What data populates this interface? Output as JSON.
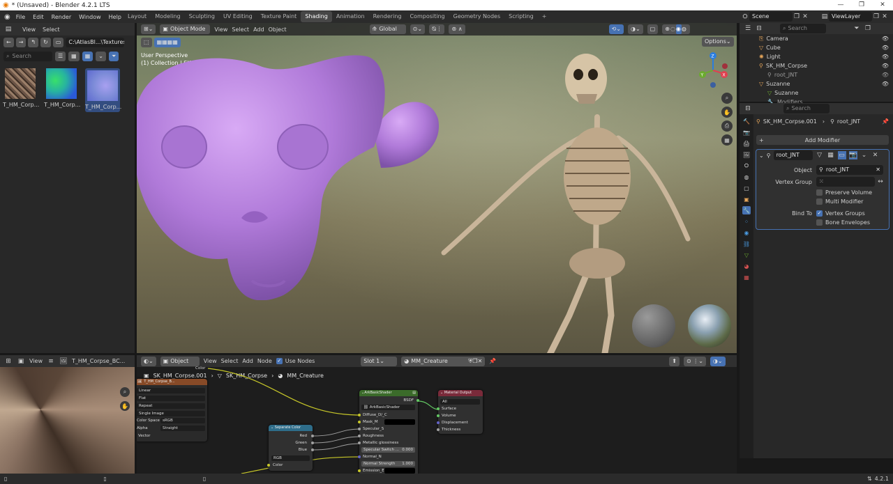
{
  "title_bar": {
    "title": "* (Unsaved) - Blender 4.2.1 LTS",
    "min": "—",
    "max": "❐",
    "close": "✕"
  },
  "menu": [
    "File",
    "Edit",
    "Render",
    "Window",
    "Help"
  ],
  "workspaces": [
    "Layout",
    "Modeling",
    "Sculpting",
    "UV Editing",
    "Texture Paint",
    "Shading",
    "Animation",
    "Rendering",
    "Compositing",
    "Geometry Nodes",
    "Scripting"
  ],
  "add_workspace": "+",
  "scene_name": "Scene",
  "view_layer": "ViewLayer",
  "file_browser": {
    "menu": [
      "View",
      "Select"
    ],
    "path": "C:\\AtlasBl...\\Textures\\",
    "search_placeholder": "Search",
    "thumbnails": [
      {
        "label": "T_HM_Corp...",
        "color": "#6b5446"
      },
      {
        "label": "T_HM_Corp...",
        "color": "#27b3a0"
      },
      {
        "label": "T_HM_Corp...",
        "color": "#7d8cd8"
      }
    ]
  },
  "viewport": {
    "mode": "Object Mode",
    "menu": [
      "View",
      "Select",
      "Add",
      "Object"
    ],
    "orientation": "Global",
    "options": "Options",
    "perspective": "User Perspective",
    "collection_text": "(1) Collection | SK_HM_Corpse.001",
    "gizmo": {
      "x": "X",
      "y": "Y",
      "z": "Z"
    },
    "suzanne_color": "#b07ad9"
  },
  "outliner": {
    "search_placeholder": "Search",
    "items": [
      {
        "label": "Camera",
        "color": "#e8a75b"
      },
      {
        "label": "Cube",
        "color": "#e8a75b"
      },
      {
        "label": "Light",
        "color": "#e8a75b"
      },
      {
        "label": "SK_HM_Corpse",
        "color": "#e8a75b"
      },
      {
        "label": "root_JNT",
        "color": "#9a9a9a"
      },
      {
        "label": "Suzanne",
        "color": "#e8a75b"
      },
      {
        "label": "Suzanne",
        "color": "#9a9a9a"
      },
      {
        "label": "Modifiers",
        "color": "#9a9a9a"
      }
    ]
  },
  "properties": {
    "search_placeholder": "Search",
    "breadcrumb_object": "SK_HM_Corpse.001",
    "breadcrumb_modifier": "root_JNT",
    "add_modifier": "Add Modifier",
    "modifier_name": "root_JNT",
    "object_label": "Object",
    "object_value": "root_JNT",
    "vertex_group_label": "Vertex Group",
    "preserve_volume": "Preserve Volume",
    "multi_modifier": "Multi Modifier",
    "bind_to_label": "Bind To",
    "vertex_groups": "Vertex Groups",
    "bone_envelopes": "Bone Envelopes"
  },
  "image_editor": {
    "menu": [
      "View"
    ],
    "image_name": "T_HM_Corpse_BC..."
  },
  "node_editor": {
    "type": "Object",
    "menu": [
      "View",
      "Select",
      "Add",
      "Node"
    ],
    "use_nodes": "Use Nodes",
    "slot": "Slot 1",
    "material": "MM_Creature",
    "breadcrumb": [
      "SK_HM_Corpse.001",
      "SK_HM_Corpse",
      "MM_Creature"
    ],
    "image_node": {
      "title": "T_HM_Corpse_B...",
      "color_out": "Color",
      "interp": "Linear",
      "projection": "Flat",
      "extension": "Repeat",
      "source": "Single Image",
      "color_space_label": "Color Space",
      "color_space": "sRGB",
      "alpha_label": "Alpha",
      "alpha": "Straight",
      "vector": "Vector"
    },
    "separate_node": {
      "title": "Separate Color",
      "red": "Red",
      "green": "Green",
      "blue": "Blue",
      "mode": "RGB",
      "color_in": "Color"
    },
    "shader_node": {
      "title": "ArkBasicShader",
      "group": "ArkBasicShader",
      "bsdf": "BSDF",
      "inputs": [
        "Diffuse_D/_C",
        "Mask_M",
        "Specular_S",
        "Roughness",
        "Metallic glossiness"
      ],
      "spec_switch_label": "Specular Switch ...",
      "spec_switch_value": "0.000",
      "normal": "Normal_N",
      "normal_strength_label": "Normal Strength",
      "normal_strength_value": "1.000",
      "emission": "Emission_E"
    },
    "output_node": {
      "title": "Material Output",
      "target": "All",
      "inputs": [
        "Surface",
        "Volume",
        "Displacement",
        "Thickness"
      ]
    }
  },
  "status": {
    "version": "4.2.1"
  }
}
